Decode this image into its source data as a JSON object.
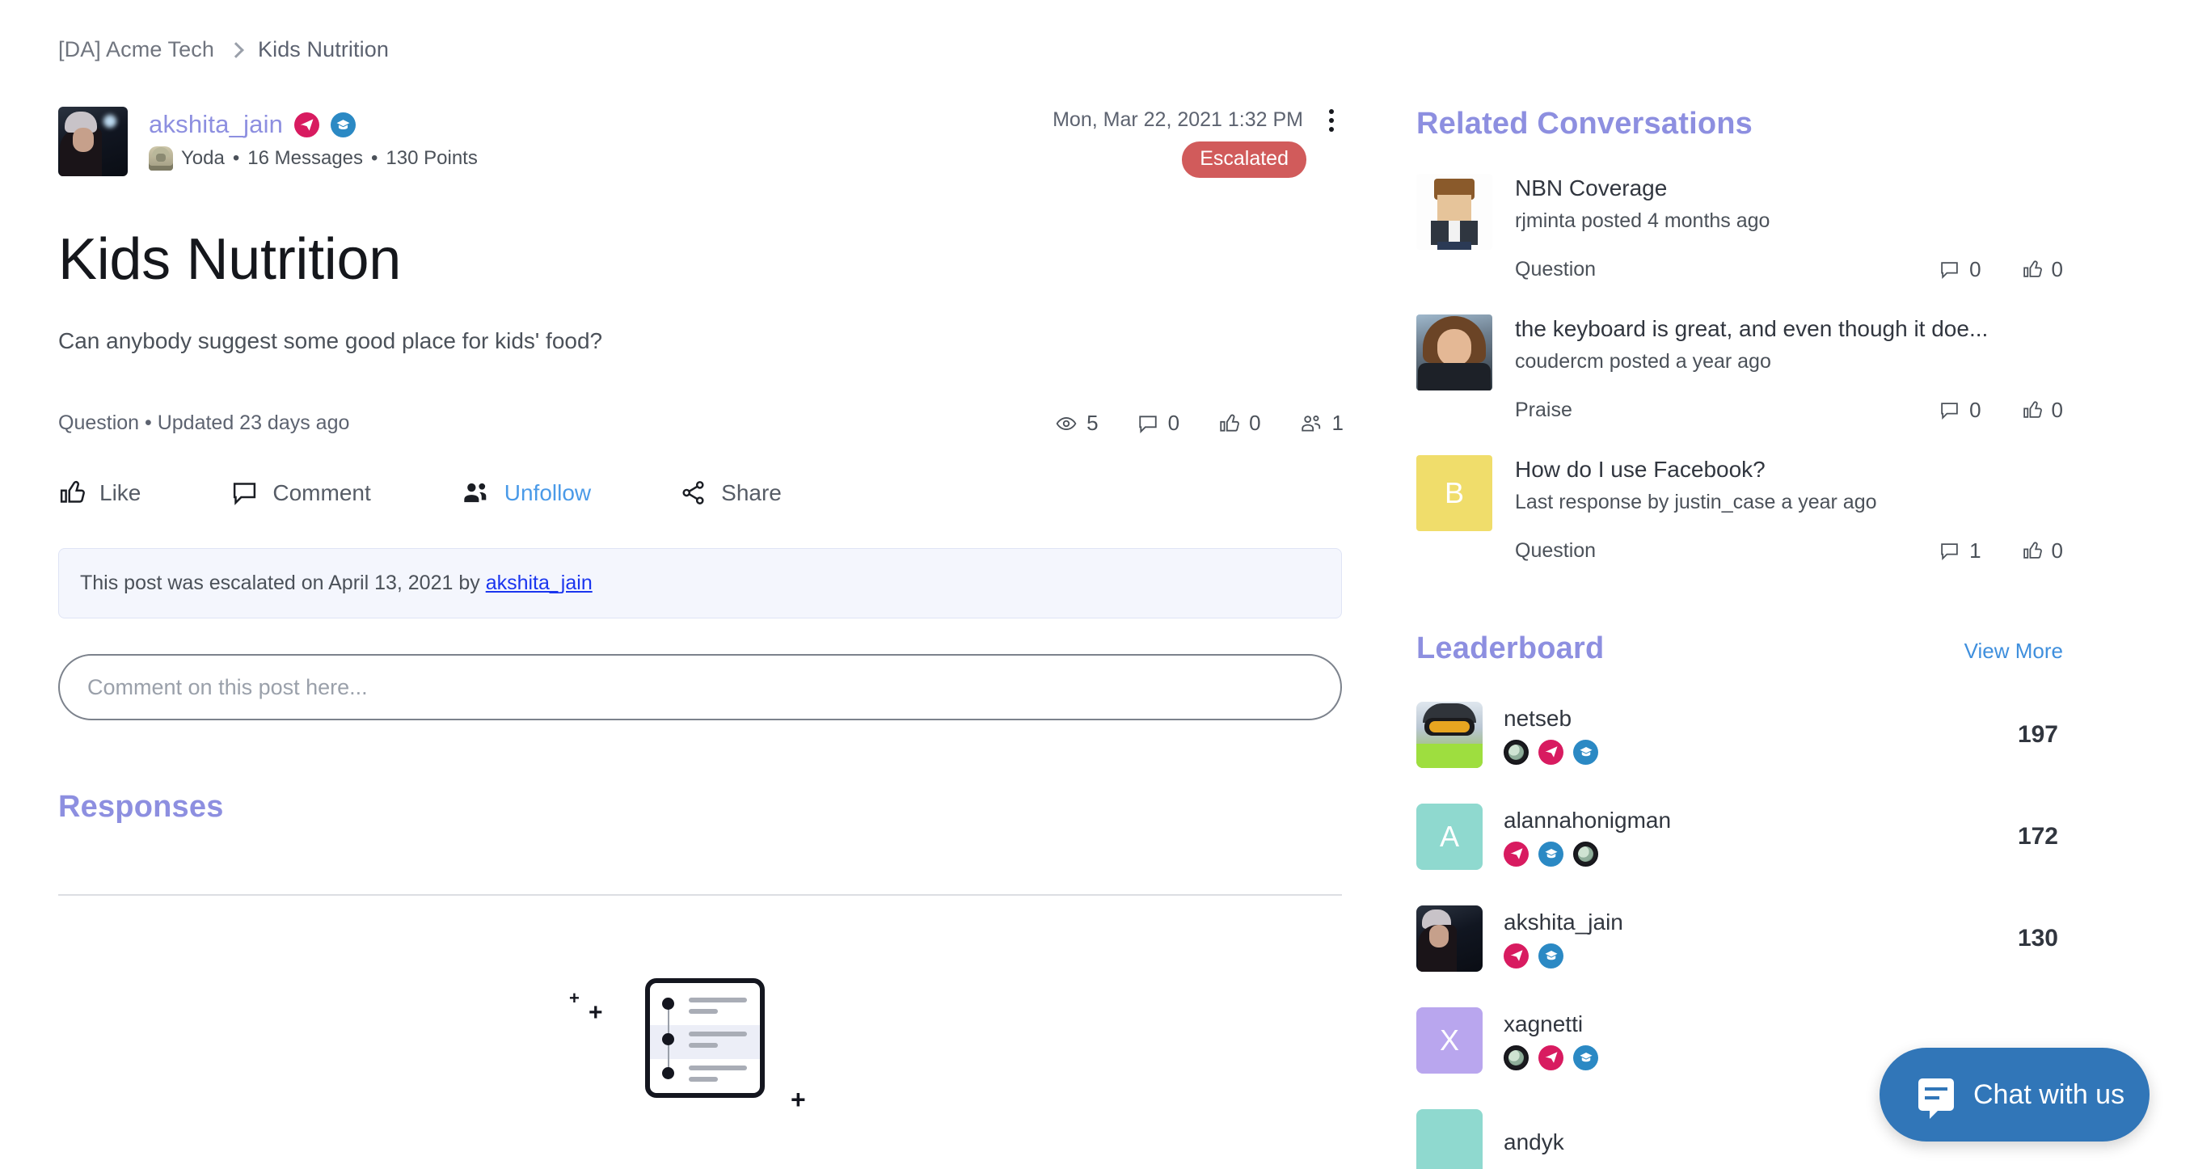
{
  "breadcrumb": {
    "root": "[DA] Acme Tech",
    "current": "Kids Nutrition"
  },
  "post": {
    "author": "akshita_jain",
    "rank": "Yoda",
    "messages": "16 Messages",
    "points": "130 Points",
    "meta_separator": "•",
    "timestamp": "Mon, Mar 22, 2021 1:32 PM",
    "status_badge": "Escalated",
    "title": "Kids Nutrition",
    "body": "Can anybody suggest some good place for kids' food?",
    "type": "Question",
    "updated": "Updated 23 days ago",
    "meta_line": "Question • Updated 23 days ago",
    "stats": {
      "views": "5",
      "comments": "0",
      "likes": "0",
      "followers": "1"
    }
  },
  "actions": {
    "like": "Like",
    "comment": "Comment",
    "follow": "Unfollow",
    "share": "Share"
  },
  "banner": {
    "text_before": "This post was escalated on April 13, 2021 by ",
    "link": "akshita_jain"
  },
  "comment_input": {
    "placeholder": "Comment on this post here..."
  },
  "responses": {
    "heading": "Responses"
  },
  "sidebar": {
    "related": {
      "heading": "Related Conversations",
      "items": [
        {
          "title": "NBN Coverage",
          "sub": "rjminta posted 4 months ago",
          "type": "Question",
          "comments": "0",
          "likes": "0",
          "avatar_kind": "pixel",
          "avatar_letter": "",
          "avatar_color": ""
        },
        {
          "title": "the keyboard is great, and even though it doe...",
          "sub": "coudercm posted a year ago",
          "type": "Praise",
          "comments": "0",
          "likes": "0",
          "avatar_kind": "photo",
          "avatar_letter": "",
          "avatar_color": ""
        },
        {
          "title": "How do I use Facebook?",
          "sub": "Last response by justin_case a year ago",
          "type": "Question",
          "comments": "1",
          "likes": "0",
          "avatar_kind": "letter",
          "avatar_letter": "B",
          "avatar_color": "#f0dd6b"
        }
      ]
    },
    "leaderboard": {
      "heading": "Leaderboard",
      "view_more": "View More",
      "items": [
        {
          "name": "netseb",
          "points": "197",
          "badges": [
            "globe",
            "plane",
            "cap"
          ],
          "avatar_kind": "ski",
          "avatar_letter": "",
          "avatar_color": ""
        },
        {
          "name": "alannahonigman",
          "points": "172",
          "badges": [
            "plane",
            "cap",
            "globe"
          ],
          "avatar_kind": "letter",
          "avatar_letter": "A",
          "avatar_color": "#8fd9cf"
        },
        {
          "name": "akshita_jain",
          "points": "130",
          "badges": [
            "plane",
            "cap"
          ],
          "avatar_kind": "user-photo",
          "avatar_letter": "",
          "avatar_color": ""
        },
        {
          "name": "xagnetti",
          "points": "",
          "badges": [
            "globe",
            "plane",
            "cap"
          ],
          "avatar_kind": "letter",
          "avatar_letter": "X",
          "avatar_color": "#b9a6ee"
        },
        {
          "name": "andyk",
          "points": "",
          "badges": [],
          "avatar_kind": "letter",
          "avatar_letter": "",
          "avatar_color": "#8fd9cf"
        }
      ]
    }
  },
  "chat_widget": {
    "label": "Chat with us"
  },
  "colors": {
    "accent_purple": "#8d8fe0",
    "link_blue": "#3f8fdd",
    "escalated_red": "#d15b5b",
    "chat_blue": "#3176b8",
    "banner_bg": "#f4f6fd"
  }
}
